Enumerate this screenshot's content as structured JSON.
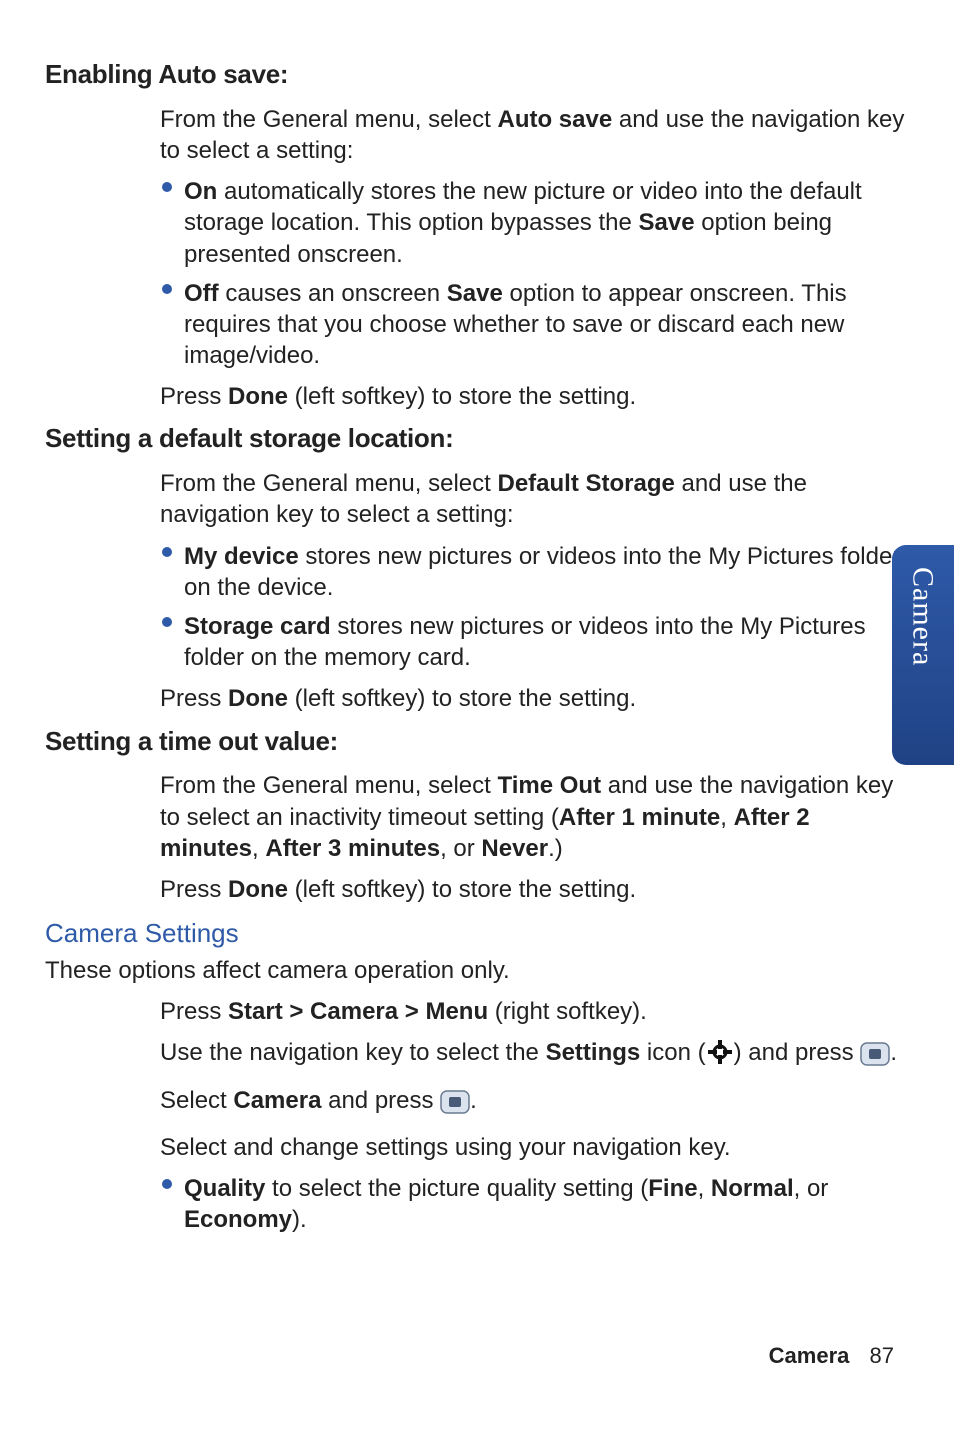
{
  "sideTab": "Camera",
  "footer": {
    "label": "Camera",
    "page": "87"
  },
  "sections": {
    "autoSave": {
      "heading": "Enabling Auto save:",
      "intro_pre": "From the General menu, select ",
      "intro_bold": "Auto save",
      "intro_post": " and use the navigation key to select a setting:",
      "items": [
        {
          "bold": "On",
          "rest_pre": " automatically stores the new picture or video into the default storage location. This option bypasses the ",
          "rest_bold": "Save",
          "rest_post": " option being presented onscreen."
        },
        {
          "bold": "Off",
          "rest_pre": " causes an onscreen ",
          "rest_bold": "Save",
          "rest_post": " option to appear onscreen. This requires that you choose whether to save or discard each new image/video."
        }
      ],
      "press_pre": "Press ",
      "press_bold": "Done",
      "press_post": " (left softkey) to store the setting."
    },
    "defaultStorage": {
      "heading": "Setting a default storage location:",
      "intro_pre": "From the General menu, select ",
      "intro_bold": "Default Storage",
      "intro_post": " and use the navigation key to select a setting:",
      "items": [
        {
          "bold": "My device",
          "rest": " stores new pictures or videos into the My Pictures folder on the device."
        },
        {
          "bold": "Storage card",
          "rest": " stores new pictures or videos into the My Pictures folder on the memory card."
        }
      ],
      "press_pre": "Press ",
      "press_bold": "Done",
      "press_post": " (left softkey) to store the setting."
    },
    "timeOut": {
      "heading": "Setting a time out value:",
      "intro_pre": "From the General menu, select ",
      "intro_bold": "Time Out",
      "intro_post": " and use the navigation key to select an inactivity timeout setting (",
      "opt1": "After 1 minute",
      "sep1": ", ",
      "opt2": "After 2 minutes",
      "sep2": ", ",
      "opt3": "After 3 minutes",
      "sep3": ", or ",
      "opt4": "Never",
      "tail": ".)",
      "press_pre": "Press ",
      "press_bold": "Done",
      "press_post": " (left softkey) to store the setting."
    },
    "cameraSettings": {
      "heading": "Camera Settings",
      "intro": "These options affect camera operation only.",
      "step1_pre": "Press ",
      "step1_bold": "Start > Camera > Menu",
      "step1_post": " (right softkey).",
      "step2_pre": "Use the navigation key to select the ",
      "step2_bold": "Settings",
      "step2_mid": " icon (",
      "step2_post": ") and press ",
      "step2_tail": ".",
      "step3_pre": "Select ",
      "step3_bold": "Camera",
      "step3_mid": " and press ",
      "step3_tail": ".",
      "step4": "Select and change settings using your navigation key.",
      "bullet_bold": "Quality",
      "bullet_pre": " to select the picture quality setting (",
      "bullet_o1": "Fine",
      "bullet_s1": ", ",
      "bullet_o2": "Normal",
      "bullet_s2": ", or ",
      "bullet_o3": "Economy",
      "bullet_tail": ")."
    }
  }
}
